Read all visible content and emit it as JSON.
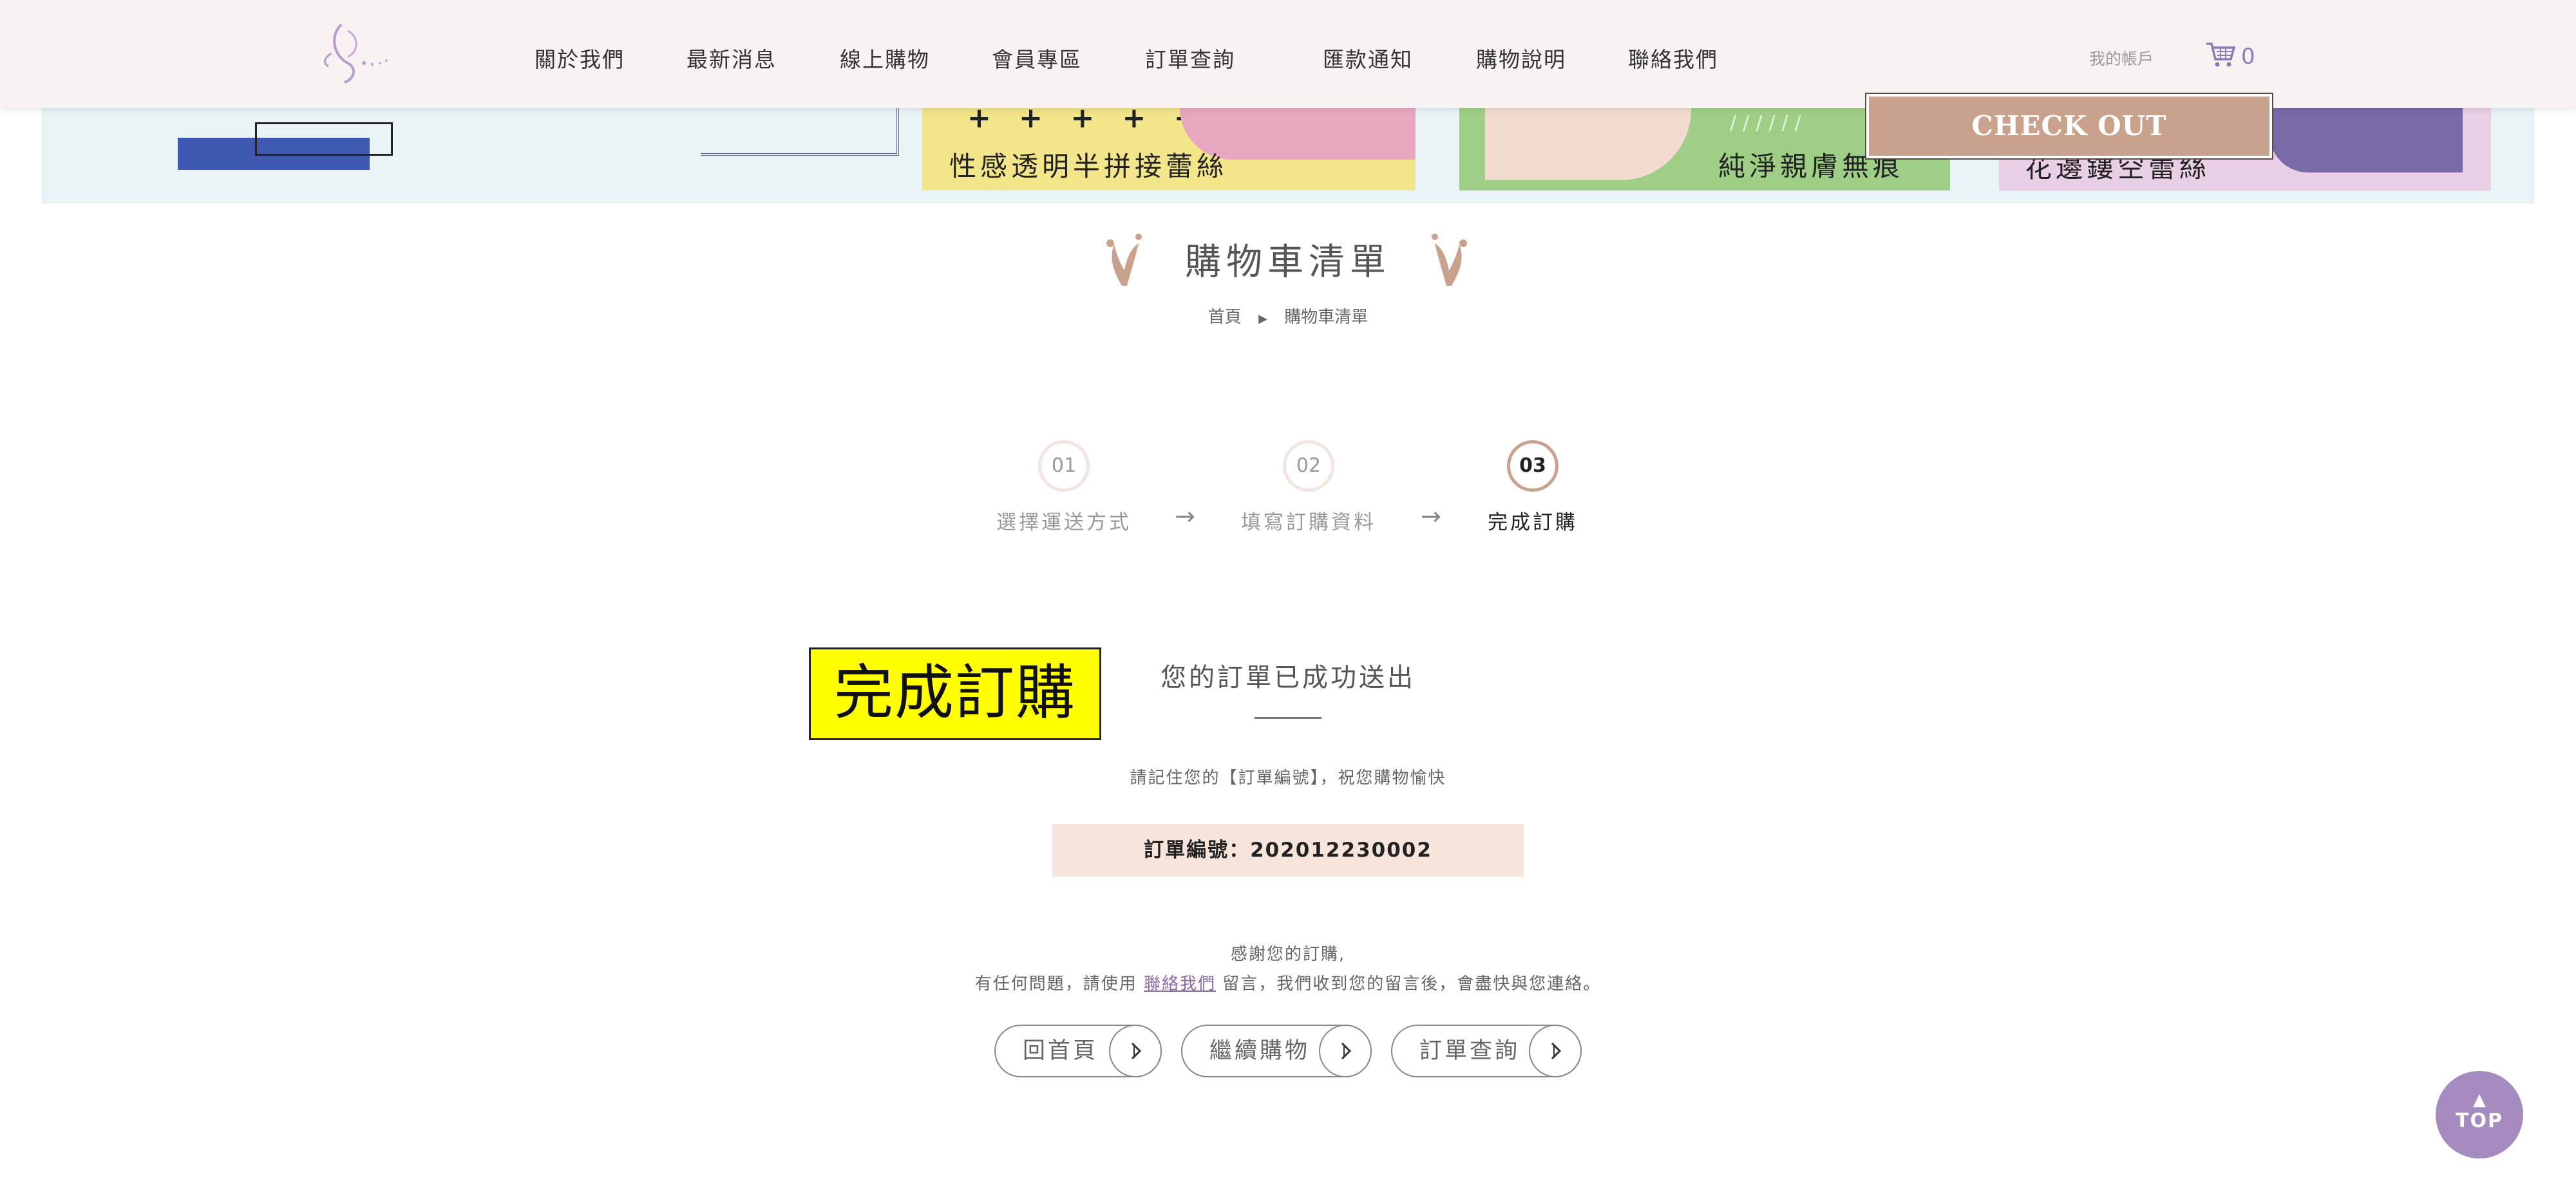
{
  "header": {
    "nav": [
      "關於我們",
      "最新消息",
      "線上購物",
      "會員專區",
      "訂單查詢",
      "匯款通知",
      "購物說明",
      "聯絡我們"
    ],
    "account": "我的帳戶",
    "cart_count": "0",
    "accent": "#c9a28d",
    "purple": "#8b7bb8"
  },
  "banner": {
    "panel1_text": "性感透明半拼接蕾絲",
    "panel1_plus": "+ + + + +",
    "panel2_text": "純淨親膚無痕",
    "panel3_text": "花邊鏤空蕾絲",
    "checkout": "CHECK OUT"
  },
  "page": {
    "title": "購物車清單",
    "breadcrumb_home": "首頁",
    "breadcrumb_current": "購物車清單"
  },
  "steps": [
    {
      "num": "01",
      "label": "選擇運送方式"
    },
    {
      "num": "02",
      "label": "填寫訂購資料"
    },
    {
      "num": "03",
      "label": "完成訂購"
    }
  ],
  "complete": {
    "badge": "完成訂購",
    "message": "您的訂單已成功送出",
    "remember": "請記住您的【訂單編號】，祝您購物愉快",
    "order_label": "訂單編號：",
    "order_number": "202012230002",
    "thanks": "感謝您的訂購,",
    "help_pre": "有任何問題，請使用",
    "help_link": "聯絡我們",
    "help_post": "留言，我們收到您的留言後，會盡快與您連絡。"
  },
  "buttons": {
    "home": "回首頁",
    "continue": "繼續購物",
    "query": "訂單查詢"
  },
  "top": "TOP"
}
